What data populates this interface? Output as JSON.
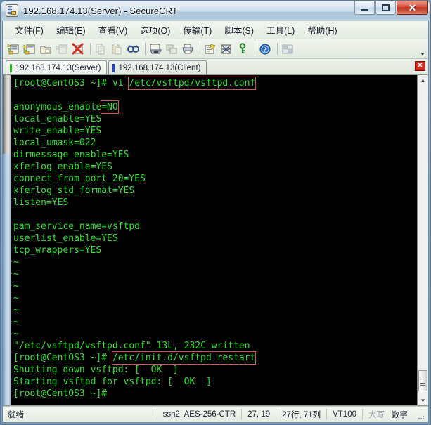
{
  "window": {
    "title": "192.168.174.13(Server) - SecureCRT",
    "icon": "securecrt-app-icon",
    "minimize_label": "–",
    "maximize_label": "□",
    "close_label": "✕"
  },
  "menubar": {
    "items": [
      {
        "label": "文件(F)",
        "name": "menu-file"
      },
      {
        "label": "编辑(E)",
        "name": "menu-edit"
      },
      {
        "label": "查看(V)",
        "name": "menu-view"
      },
      {
        "label": "选项(O)",
        "name": "menu-options"
      },
      {
        "label": "传输(T)",
        "name": "menu-transfer"
      },
      {
        "label": "脚本(S)",
        "name": "menu-script"
      },
      {
        "label": "工具(L)",
        "name": "menu-tools"
      },
      {
        "label": "帮助(H)",
        "name": "menu-help"
      }
    ]
  },
  "toolbar": {
    "overflow_label": "▾",
    "buttons": [
      "new-session-icon",
      "connect-sftp-icon",
      "clone-session-icon",
      "reconnect-icon",
      "disconnect-icon",
      "copy-icon",
      "paste-icon",
      "find-icon",
      "print-screen-icon",
      "log-session-icon",
      "print-icon",
      "session-options-icon",
      "toggle-chat-icon",
      "key-icon",
      "help-icon",
      "tile-windows-icon"
    ]
  },
  "tabs": {
    "close_label": "✕",
    "items": [
      {
        "label": "192.168.174.13(Server)",
        "active": true,
        "marker_color": "#18c018"
      },
      {
        "label": "192.168.174.13(Client)",
        "active": false,
        "marker_color": "#2040d8"
      }
    ]
  },
  "terminal": {
    "fg": "#2ee02e",
    "bg": "#000000",
    "highlight_color": "#d0564f",
    "lines": [
      {
        "segments": [
          {
            "text": "[root@CentOS3 ~]# vi ",
            "cls": "g"
          },
          {
            "text": "/etc/vsftpd/vsftpd.conf",
            "cls": "g",
            "highlight": true
          }
        ]
      },
      {
        "segments": [
          {
            "text": "",
            "cls": "g"
          }
        ]
      },
      {
        "segments": [
          {
            "text": "anonymous_enable",
            "cls": "g"
          },
          {
            "text": "=NO",
            "cls": "g",
            "highlight": true
          }
        ]
      },
      {
        "segments": [
          {
            "text": "local_enable=YES",
            "cls": "g"
          }
        ]
      },
      {
        "segments": [
          {
            "text": "write_enable=YES",
            "cls": "g"
          }
        ]
      },
      {
        "segments": [
          {
            "text": "local_umask=022",
            "cls": "g"
          }
        ]
      },
      {
        "segments": [
          {
            "text": "dirmessage_enable=YES",
            "cls": "g"
          }
        ]
      },
      {
        "segments": [
          {
            "text": "xferlog_enable=YES",
            "cls": "g"
          }
        ]
      },
      {
        "segments": [
          {
            "text": "connect_from_port_20=YES",
            "cls": "g"
          }
        ]
      },
      {
        "segments": [
          {
            "text": "xferlog_std_format=YES",
            "cls": "g"
          }
        ]
      },
      {
        "segments": [
          {
            "text": "listen=YES",
            "cls": "g"
          }
        ]
      },
      {
        "segments": [
          {
            "text": "",
            "cls": "g"
          }
        ]
      },
      {
        "segments": [
          {
            "text": "pam_service_name=vsftpd",
            "cls": "g"
          }
        ]
      },
      {
        "segments": [
          {
            "text": "userlist_enable=YES",
            "cls": "g"
          }
        ]
      },
      {
        "segments": [
          {
            "text": "tcp_wrappers=YES",
            "cls": "g"
          }
        ]
      },
      {
        "segments": [
          {
            "text": "~",
            "cls": "g"
          }
        ]
      },
      {
        "segments": [
          {
            "text": "~",
            "cls": "g"
          }
        ]
      },
      {
        "segments": [
          {
            "text": "~",
            "cls": "g"
          }
        ]
      },
      {
        "segments": [
          {
            "text": "~",
            "cls": "g"
          }
        ]
      },
      {
        "segments": [
          {
            "text": "~",
            "cls": "g"
          }
        ]
      },
      {
        "segments": [
          {
            "text": "~",
            "cls": "g"
          }
        ]
      },
      {
        "segments": [
          {
            "text": "~",
            "cls": "g"
          }
        ]
      },
      {
        "segments": [
          {
            "text": "\"/etc/vsftpd/vsftpd.conf\" 13L, 232C written",
            "cls": "g"
          }
        ]
      },
      {
        "segments": [
          {
            "text": "[root@CentOS3 ~]# ",
            "cls": "g"
          },
          {
            "text": "/etc/init.d/vsftpd restart",
            "cls": "g",
            "highlight": true
          }
        ]
      },
      {
        "segments": [
          {
            "text": "Shutting down vsftpd: [  OK  ]",
            "cls": "g"
          }
        ]
      },
      {
        "segments": [
          {
            "text": "Starting vsftpd for vsftpd: [  OK  ]",
            "cls": "g"
          }
        ]
      },
      {
        "segments": [
          {
            "text": "[root@CentOS3 ~]#",
            "cls": "g"
          }
        ]
      }
    ]
  },
  "scrollbars": {
    "left_up": "",
    "right_up": "▲",
    "right_down": "▼"
  },
  "statusbar": {
    "ready": "就绪",
    "cipher": "ssh2: AES-256-CTR",
    "cursor": "27, 19",
    "size": "27行, 71列",
    "emulation": "VT100",
    "caps": "大写",
    "num": "数字"
  }
}
